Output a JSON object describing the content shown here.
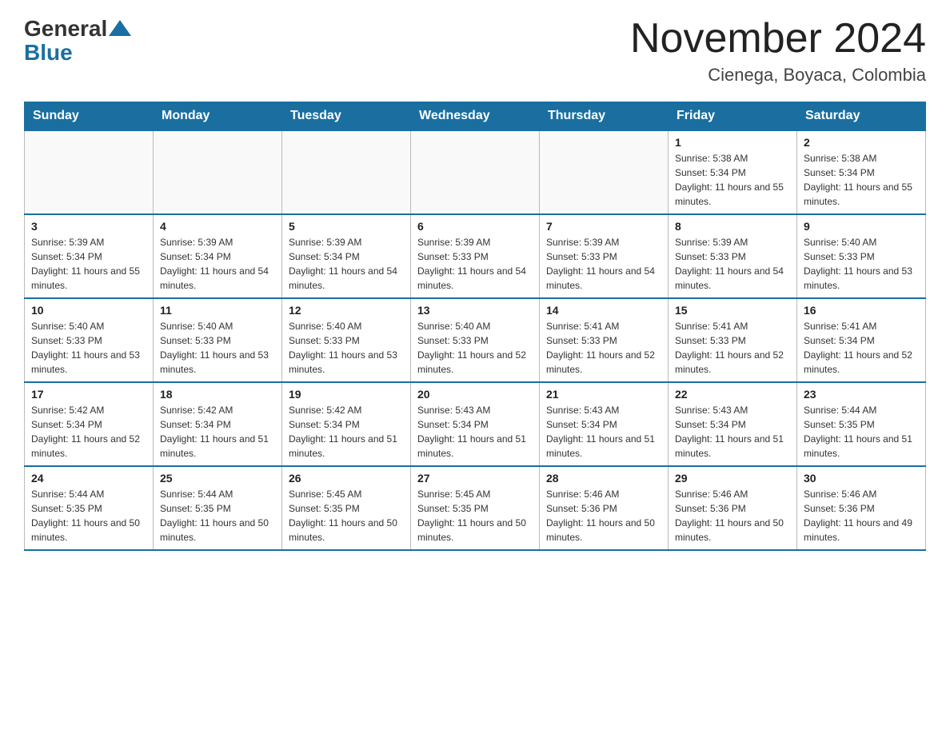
{
  "logo": {
    "general": "General",
    "blue": "Blue"
  },
  "header": {
    "title": "November 2024",
    "subtitle": "Cienega, Boyaca, Colombia"
  },
  "weekdays": [
    "Sunday",
    "Monday",
    "Tuesday",
    "Wednesday",
    "Thursday",
    "Friday",
    "Saturday"
  ],
  "weeks": [
    [
      {
        "day": "",
        "info": ""
      },
      {
        "day": "",
        "info": ""
      },
      {
        "day": "",
        "info": ""
      },
      {
        "day": "",
        "info": ""
      },
      {
        "day": "",
        "info": ""
      },
      {
        "day": "1",
        "info": "Sunrise: 5:38 AM\nSunset: 5:34 PM\nDaylight: 11 hours and 55 minutes."
      },
      {
        "day": "2",
        "info": "Sunrise: 5:38 AM\nSunset: 5:34 PM\nDaylight: 11 hours and 55 minutes."
      }
    ],
    [
      {
        "day": "3",
        "info": "Sunrise: 5:39 AM\nSunset: 5:34 PM\nDaylight: 11 hours and 55 minutes."
      },
      {
        "day": "4",
        "info": "Sunrise: 5:39 AM\nSunset: 5:34 PM\nDaylight: 11 hours and 54 minutes."
      },
      {
        "day": "5",
        "info": "Sunrise: 5:39 AM\nSunset: 5:34 PM\nDaylight: 11 hours and 54 minutes."
      },
      {
        "day": "6",
        "info": "Sunrise: 5:39 AM\nSunset: 5:33 PM\nDaylight: 11 hours and 54 minutes."
      },
      {
        "day": "7",
        "info": "Sunrise: 5:39 AM\nSunset: 5:33 PM\nDaylight: 11 hours and 54 minutes."
      },
      {
        "day": "8",
        "info": "Sunrise: 5:39 AM\nSunset: 5:33 PM\nDaylight: 11 hours and 54 minutes."
      },
      {
        "day": "9",
        "info": "Sunrise: 5:40 AM\nSunset: 5:33 PM\nDaylight: 11 hours and 53 minutes."
      }
    ],
    [
      {
        "day": "10",
        "info": "Sunrise: 5:40 AM\nSunset: 5:33 PM\nDaylight: 11 hours and 53 minutes."
      },
      {
        "day": "11",
        "info": "Sunrise: 5:40 AM\nSunset: 5:33 PM\nDaylight: 11 hours and 53 minutes."
      },
      {
        "day": "12",
        "info": "Sunrise: 5:40 AM\nSunset: 5:33 PM\nDaylight: 11 hours and 53 minutes."
      },
      {
        "day": "13",
        "info": "Sunrise: 5:40 AM\nSunset: 5:33 PM\nDaylight: 11 hours and 52 minutes."
      },
      {
        "day": "14",
        "info": "Sunrise: 5:41 AM\nSunset: 5:33 PM\nDaylight: 11 hours and 52 minutes."
      },
      {
        "day": "15",
        "info": "Sunrise: 5:41 AM\nSunset: 5:33 PM\nDaylight: 11 hours and 52 minutes."
      },
      {
        "day": "16",
        "info": "Sunrise: 5:41 AM\nSunset: 5:34 PM\nDaylight: 11 hours and 52 minutes."
      }
    ],
    [
      {
        "day": "17",
        "info": "Sunrise: 5:42 AM\nSunset: 5:34 PM\nDaylight: 11 hours and 52 minutes."
      },
      {
        "day": "18",
        "info": "Sunrise: 5:42 AM\nSunset: 5:34 PM\nDaylight: 11 hours and 51 minutes."
      },
      {
        "day": "19",
        "info": "Sunrise: 5:42 AM\nSunset: 5:34 PM\nDaylight: 11 hours and 51 minutes."
      },
      {
        "day": "20",
        "info": "Sunrise: 5:43 AM\nSunset: 5:34 PM\nDaylight: 11 hours and 51 minutes."
      },
      {
        "day": "21",
        "info": "Sunrise: 5:43 AM\nSunset: 5:34 PM\nDaylight: 11 hours and 51 minutes."
      },
      {
        "day": "22",
        "info": "Sunrise: 5:43 AM\nSunset: 5:34 PM\nDaylight: 11 hours and 51 minutes."
      },
      {
        "day": "23",
        "info": "Sunrise: 5:44 AM\nSunset: 5:35 PM\nDaylight: 11 hours and 51 minutes."
      }
    ],
    [
      {
        "day": "24",
        "info": "Sunrise: 5:44 AM\nSunset: 5:35 PM\nDaylight: 11 hours and 50 minutes."
      },
      {
        "day": "25",
        "info": "Sunrise: 5:44 AM\nSunset: 5:35 PM\nDaylight: 11 hours and 50 minutes."
      },
      {
        "day": "26",
        "info": "Sunrise: 5:45 AM\nSunset: 5:35 PM\nDaylight: 11 hours and 50 minutes."
      },
      {
        "day": "27",
        "info": "Sunrise: 5:45 AM\nSunset: 5:35 PM\nDaylight: 11 hours and 50 minutes."
      },
      {
        "day": "28",
        "info": "Sunrise: 5:46 AM\nSunset: 5:36 PM\nDaylight: 11 hours and 50 minutes."
      },
      {
        "day": "29",
        "info": "Sunrise: 5:46 AM\nSunset: 5:36 PM\nDaylight: 11 hours and 50 minutes."
      },
      {
        "day": "30",
        "info": "Sunrise: 5:46 AM\nSunset: 5:36 PM\nDaylight: 11 hours and 49 minutes."
      }
    ]
  ]
}
